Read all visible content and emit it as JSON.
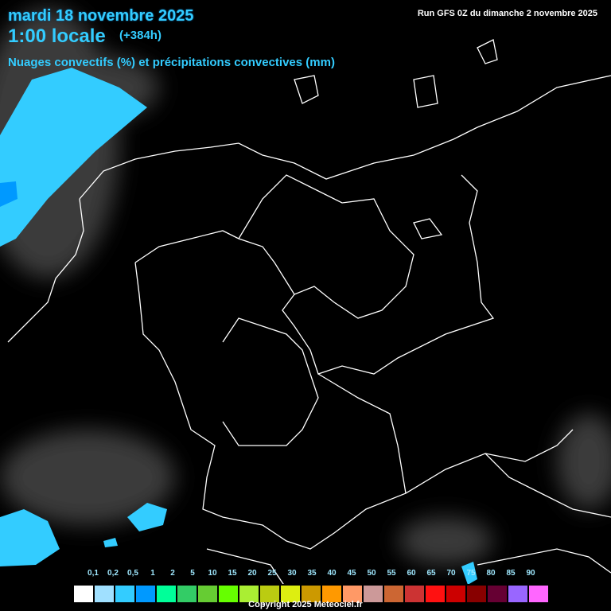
{
  "header": {
    "date": "mardi 18 novembre 2025",
    "time": "1:00 locale",
    "lead": "(+384h)",
    "title": "Nuages convectifs (%) et précipitations convectives (mm)",
    "run": "Run GFS 0Z du dimanche 2 novembre 2025"
  },
  "legend": {
    "labels": [
      "0,1",
      "0,2",
      "0,5",
      "1",
      "2",
      "5",
      "10",
      "15",
      "20",
      "25",
      "30",
      "35",
      "40",
      "45",
      "50",
      "55",
      "60",
      "65",
      "70",
      "75",
      "80",
      "85",
      "90"
    ],
    "colors": [
      "#ffffff",
      "#a0e0ff",
      "#33ccff",
      "#0099ff",
      "#00ff99",
      "#33cc66",
      "#66cc33",
      "#66ff00",
      "#aaee33",
      "#bbcc11",
      "#ddee11",
      "#cc9900",
      "#ff9900",
      "#ff9966",
      "#cc9999",
      "#cc6633",
      "#cc3333",
      "#ff1111",
      "#cc0000",
      "#880000",
      "#660033",
      "#9966ff",
      "#ff66ff"
    ]
  },
  "footer": {
    "copyright": "Copyright 2025 Meteociel.fr"
  }
}
